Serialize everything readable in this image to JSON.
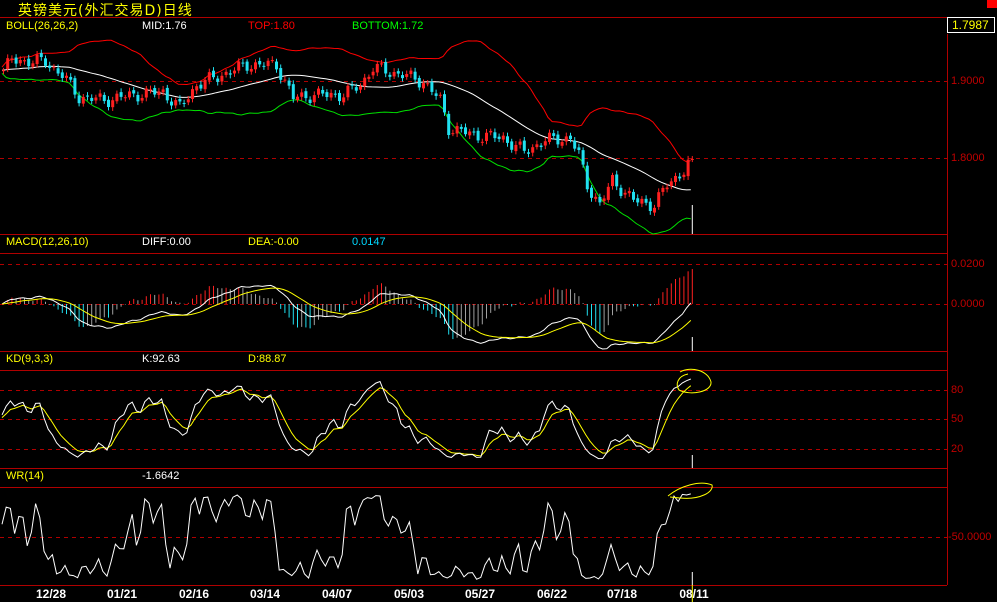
{
  "title": "英镑美元(外汇交易D)日线",
  "last_price": "1.7987",
  "panels": {
    "boll": {
      "name": "BOLL(26,26,2)",
      "mid": "MID:1.76",
      "top": "TOP:1.80",
      "bottom": "BOTTOM:1.72"
    },
    "macd": {
      "name": "MACD(12,26,10)",
      "diff": "DIFF:0.00",
      "dea": "DEA:-0.00",
      "macd": "0.0147"
    },
    "kd": {
      "name": "KD(9,3,3)",
      "k": "K:92.63",
      "d": "D:88.87"
    },
    "wr": {
      "name": "WR(14)",
      "value": "-1.6642"
    }
  },
  "colors": {
    "up": "#ff2020",
    "down": "#20e0f0",
    "mid": "#ffffff",
    "top": "#ff0000",
    "bottom": "#00e000",
    "grid": "#c00000",
    "signal": "#ffff00"
  },
  "chart_data": {
    "type": "candlestick",
    "title": "英镑美元(外汇交易D)日线",
    "bars": 165,
    "x_ticks": [
      "12/28",
      "01/21",
      "02/16",
      "03/14",
      "04/07",
      "05/03",
      "05/27",
      "06/22",
      "07/18",
      "08/11"
    ],
    "price_axis": {
      "ticks": [
        "1.9000",
        "1.8000"
      ],
      "range": [
        1.7,
        1.97
      ]
    },
    "macd_axis": {
      "ticks": [
        "0.0200",
        "0.0000"
      ]
    },
    "kd_axis": {
      "ticks": [
        "80",
        "50",
        "20"
      ],
      "range": [
        0,
        100
      ]
    },
    "wr_axis": {
      "ticks": [
        "-50.0000"
      ],
      "range": [
        -100,
        0
      ]
    },
    "close_keypoints": [
      [
        0,
        1.914
      ],
      [
        2,
        1.927
      ],
      [
        10,
        1.925
      ],
      [
        14,
        1.908
      ],
      [
        18,
        1.879
      ],
      [
        24,
        1.875
      ],
      [
        31,
        1.882
      ],
      [
        38,
        1.886
      ],
      [
        42,
        1.865
      ],
      [
        46,
        1.895
      ],
      [
        52,
        1.908
      ],
      [
        58,
        1.921
      ],
      [
        65,
        1.921
      ],
      [
        69,
        1.878
      ],
      [
        74,
        1.882
      ],
      [
        81,
        1.882
      ],
      [
        85,
        1.895
      ],
      [
        88,
        1.917
      ],
      [
        95,
        1.908
      ],
      [
        100,
        1.899
      ],
      [
        104,
        1.875
      ],
      [
        106,
        1.839
      ],
      [
        112,
        1.83
      ],
      [
        119,
        1.826
      ],
      [
        124,
        1.808
      ],
      [
        129,
        1.823
      ],
      [
        135,
        1.826
      ],
      [
        137,
        1.804
      ],
      [
        139,
        1.765
      ],
      [
        142,
        1.739
      ],
      [
        145,
        1.771
      ],
      [
        150,
        1.745
      ],
      [
        155,
        1.739
      ],
      [
        158,
        1.765
      ],
      [
        162,
        1.784
      ],
      [
        164,
        1.7987
      ]
    ]
  }
}
